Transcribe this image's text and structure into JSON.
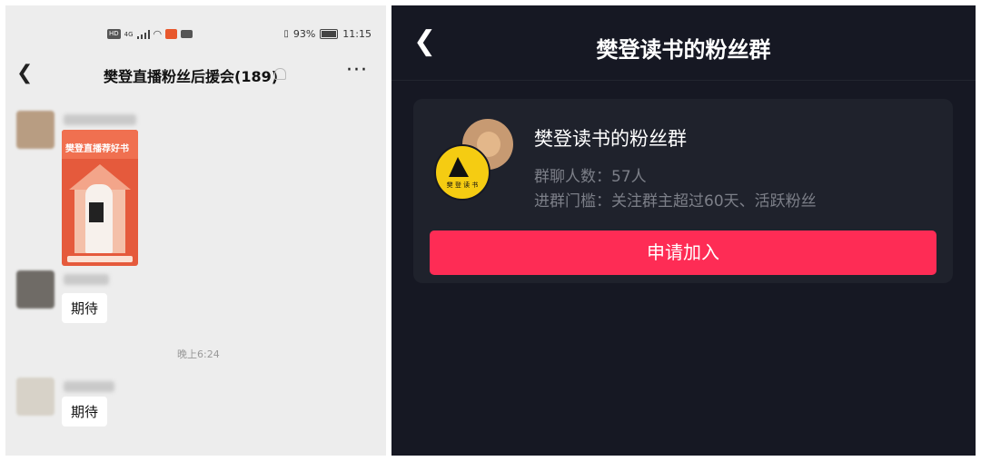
{
  "left_screen": {
    "status_bar": {
      "network_badge": "HD",
      "network_type": "4G",
      "battery": "93%",
      "time": "11:15"
    },
    "header": {
      "title": "樊登直播粉丝后援会(189)"
    },
    "poster": {
      "title": "樊登直播荐好书"
    },
    "messages": [
      {
        "text": "期待"
      },
      {
        "text": "期待"
      }
    ],
    "timestamp": "晚上6:24"
  },
  "right_screen": {
    "title": "樊登读书的粉丝群",
    "card": {
      "group_name": "樊登读书的粉丝群",
      "member_count": "群聊人数：57人",
      "requirement": "进群门槛：关注群主超过60天、活跃粉丝",
      "avatar_label": "樊 登 读 书"
    },
    "join_button": "申请加入"
  },
  "colors": {
    "accent": "#fe2c55",
    "dark_bg": "#161823",
    "card_bg": "#1f222c",
    "chat_bg": "#ededed"
  }
}
